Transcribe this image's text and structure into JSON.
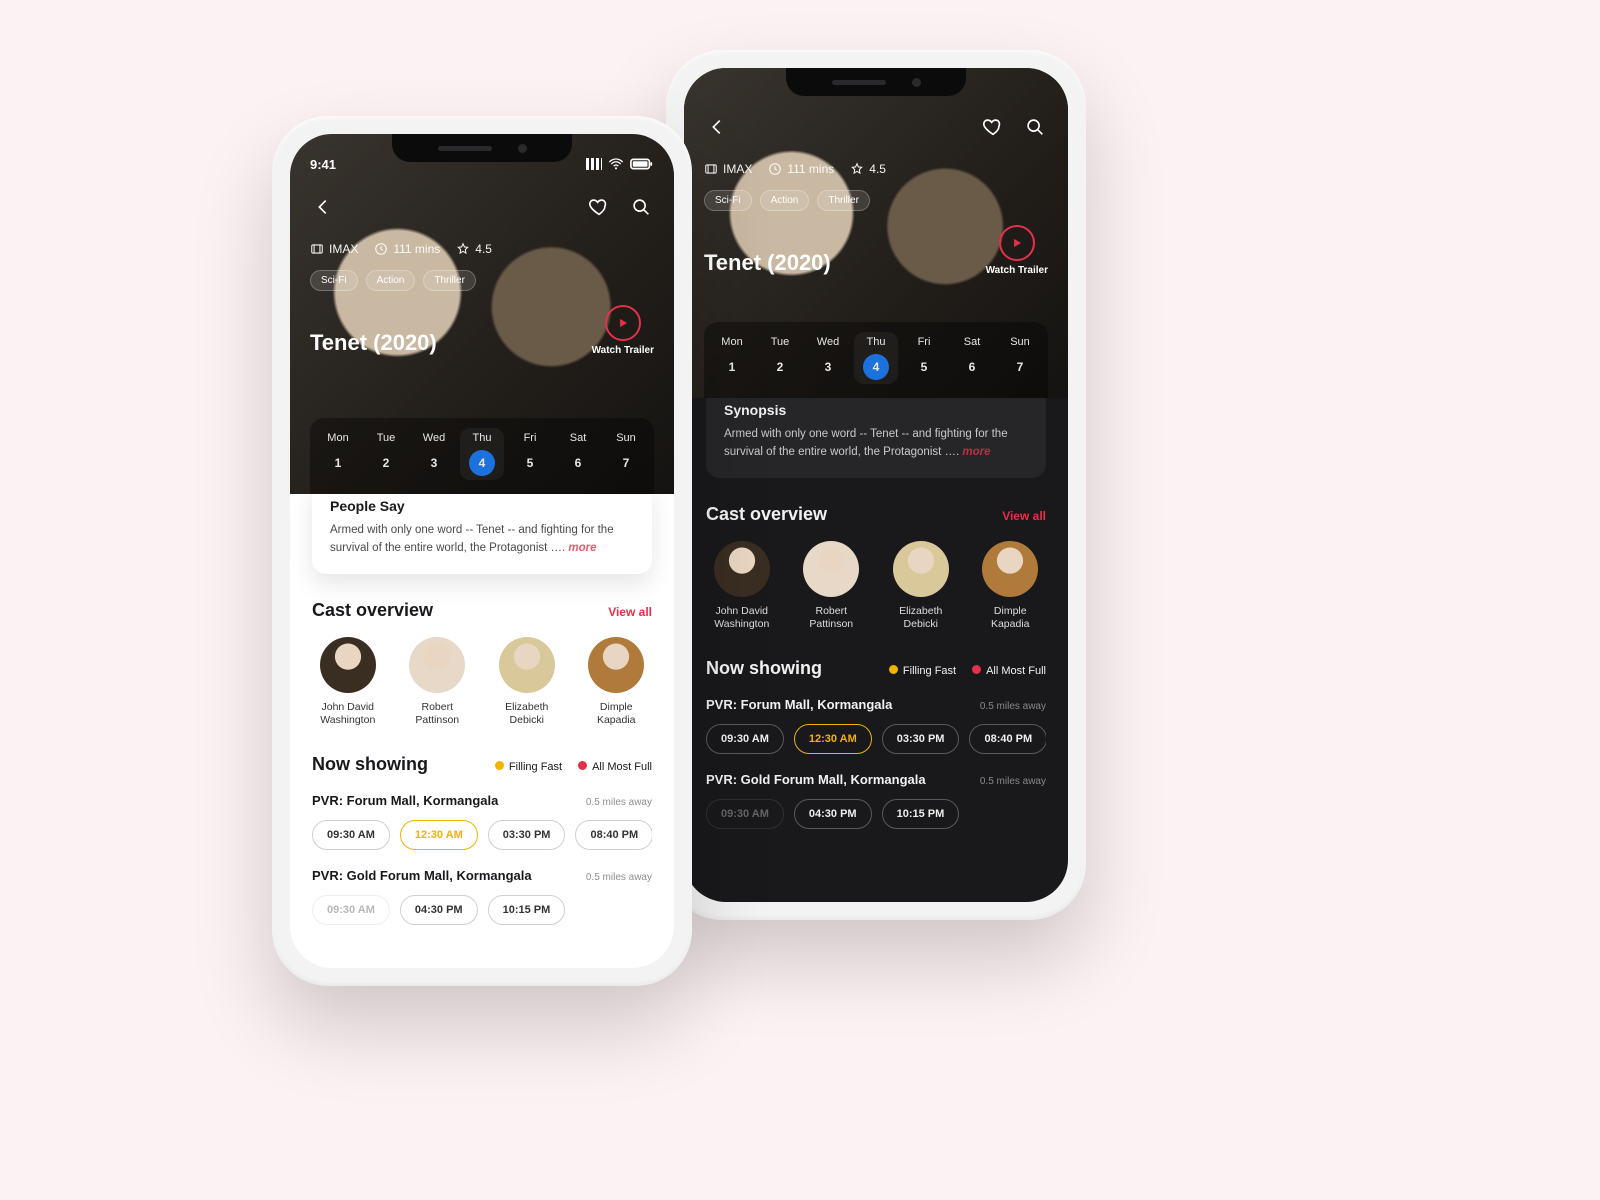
{
  "status_time": "9:41",
  "movie": {
    "format": "IMAX",
    "runtime": "111 mins",
    "rating": "4.5",
    "tags": [
      "Sci-Fi",
      "Action",
      "Thriller"
    ],
    "title": "Tenet (2020)",
    "trailer_label": "Watch Trailer"
  },
  "dates": [
    {
      "dow": "Mon",
      "num": "1"
    },
    {
      "dow": "Tue",
      "num": "2"
    },
    {
      "dow": "Wed",
      "num": "3"
    },
    {
      "dow": "Thu",
      "num": "4",
      "selected": true
    },
    {
      "dow": "Fri",
      "num": "5"
    },
    {
      "dow": "Sat",
      "num": "6"
    },
    {
      "dow": "Sun",
      "num": "7"
    }
  ],
  "synopsis": {
    "heading_light": "People Say",
    "heading_dark": "Synopsis",
    "text": "Armed with only one word -- Tenet -- and fighting for the survival of the entire world, the Protagonist …. ",
    "more": "more"
  },
  "cast": {
    "heading": "Cast overview",
    "viewall": "View all",
    "items": [
      {
        "name": "John David Washington",
        "bg": "#3a2d22"
      },
      {
        "name": "Robert Pattinson",
        "bg": "#e7d8c8"
      },
      {
        "name": "Elizabeth Debicki",
        "bg": "#d9c89a"
      },
      {
        "name": "Dimple Kapadia",
        "bg": "#b07a3a"
      }
    ]
  },
  "showing": {
    "heading": "Now showing",
    "legend": {
      "filling": "Filling Fast",
      "full": "All Most Full"
    },
    "venues": [
      {
        "name": "PVR: Forum Mall, Kormangala",
        "distance": "0.5 miles away",
        "slots": [
          {
            "t": "09:30 AM"
          },
          {
            "t": "12:30 AM",
            "state": "filling"
          },
          {
            "t": "03:30 PM"
          },
          {
            "t": "08:40 PM"
          }
        ]
      },
      {
        "name": "PVR: Gold Forum Mall, Kormangala",
        "distance": "0.5 miles away",
        "slots": [
          {
            "t": "09:30 AM",
            "state": "disabled"
          },
          {
            "t": "04:30 PM"
          },
          {
            "t": "10:15 PM"
          }
        ]
      }
    ]
  }
}
